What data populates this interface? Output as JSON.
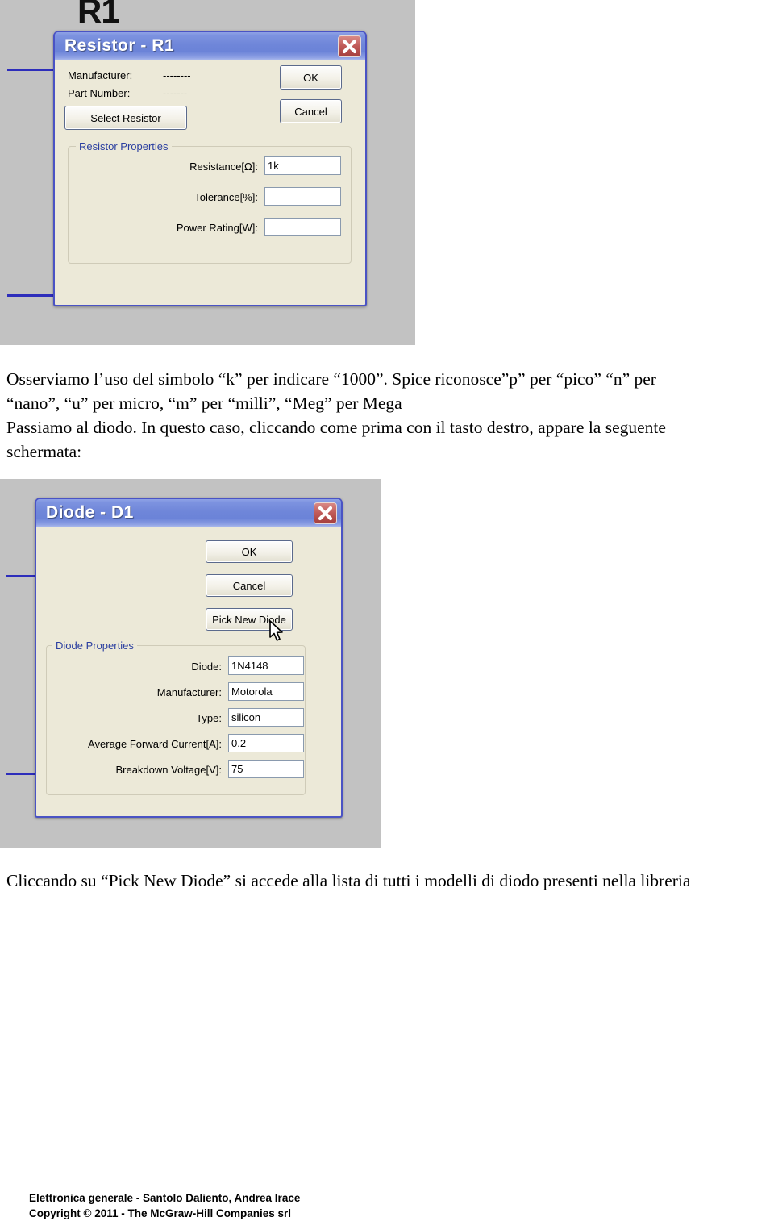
{
  "page": {
    "prose_lines": [
      "Osserviamo l’uso del simbolo “k” per indicare “1000”. Spice riconosce”p” per “pico” “n” per",
      "“nano”, “u” per micro, “m” per “milli”, “Meg” per Mega",
      "Passiamo al diodo. In questo caso, cliccando come prima con il tasto destro, appare la seguente",
      "schermata:"
    ],
    "caption_line": "Cliccando su “Pick New Diode” si accede alla lista di tutti i modelli di diodo presenti nella libreria"
  },
  "footer": {
    "line1": "Elettronica generale - Santolo Daliento, Andrea Irace",
    "line2": "Copyright © 2011 - The McGraw-Hill Companies srl"
  },
  "resistor_dialog": {
    "title": "Resistor - R1",
    "close_label": "✕",
    "schematic_label": "R1",
    "manufacturer_label": "Manufacturer:",
    "manufacturer_value": "--------",
    "part_number_label": "Part Number:",
    "part_number_value": "-------",
    "select_button": "Select Resistor",
    "ok_button": "OK",
    "cancel_button": "Cancel",
    "group_title": "Resistor Properties",
    "fields": [
      {
        "label": "Resistance[Ω]:",
        "value": "1k"
      },
      {
        "label": "Tolerance[%]:",
        "value": ""
      },
      {
        "label": "Power Rating[W]:",
        "value": ""
      }
    ]
  },
  "diode_dialog": {
    "title": "Diode - D1",
    "close_label": "✕",
    "ok_button": "OK",
    "cancel_button": "Cancel",
    "pick_button": "Pick New Diode",
    "group_title": "Diode Properties",
    "fields": [
      {
        "label": "Diode:",
        "value": "1N4148"
      },
      {
        "label": "Manufacturer:",
        "value": "Motorola"
      },
      {
        "label": "Type:",
        "value": "silicon"
      },
      {
        "label": "Average Forward Current[A]:",
        "value": "0.2"
      },
      {
        "label": "Breakdown Voltage[V]:",
        "value": "75"
      }
    ]
  },
  "colors": {
    "screenshot_bg": "#c2c2c2",
    "titlebar_blue": "#6f86d9",
    "dialog_face": "#ece9d8",
    "wire_blue": "#2d2dbb",
    "group_title_blue": "#2b3fa0",
    "close_red": "#b4504e"
  }
}
